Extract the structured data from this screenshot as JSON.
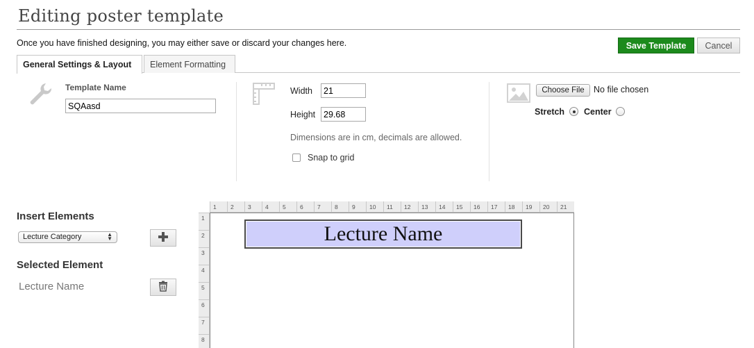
{
  "header": {
    "title": "Editing poster template",
    "intro": "Once you have finished designing, you may either save or discard your changes here.",
    "save_label": "Save Template",
    "cancel_label": "Cancel"
  },
  "tabs": [
    {
      "label": "General Settings & Layout",
      "active": true
    },
    {
      "label": "Element Formatting",
      "active": false
    }
  ],
  "settings": {
    "template_name_label": "Template Name",
    "template_name_value": "SQAasd",
    "width_label": "Width",
    "width_value": "21",
    "height_label": "Height",
    "height_value": "29.68",
    "dimensions_hint": "Dimensions are in cm, decimals are allowed.",
    "snap_label": "Snap to grid",
    "snap_checked": false,
    "choose_file_label": "Choose File",
    "file_status": "No file chosen",
    "stretch_label": "Stretch",
    "center_label": "Center",
    "selected_mode": "Stretch"
  },
  "sidebar": {
    "insert_heading": "Insert Elements",
    "insert_selected": "Lecture Category",
    "selected_heading": "Selected Element",
    "selected_name": "Lecture Name"
  },
  "canvas": {
    "ruler_top": [
      "1",
      "2",
      "3",
      "4",
      "5",
      "6",
      "7",
      "8",
      "9",
      "10",
      "11",
      "12",
      "13",
      "14",
      "15",
      "16",
      "17",
      "18",
      "19",
      "20",
      "21"
    ],
    "ruler_left": [
      "1",
      "2",
      "3",
      "4",
      "5",
      "6",
      "7",
      "8"
    ],
    "element_text": "Lecture Name",
    "element_color": "#cfcffb"
  },
  "colors": {
    "save_button": "#1c8a1c"
  },
  "icons": {
    "template": "wrench-icon",
    "dimensions": "ruler-icon",
    "background": "image-icon",
    "add": "plus-icon",
    "delete": "trash-icon"
  }
}
